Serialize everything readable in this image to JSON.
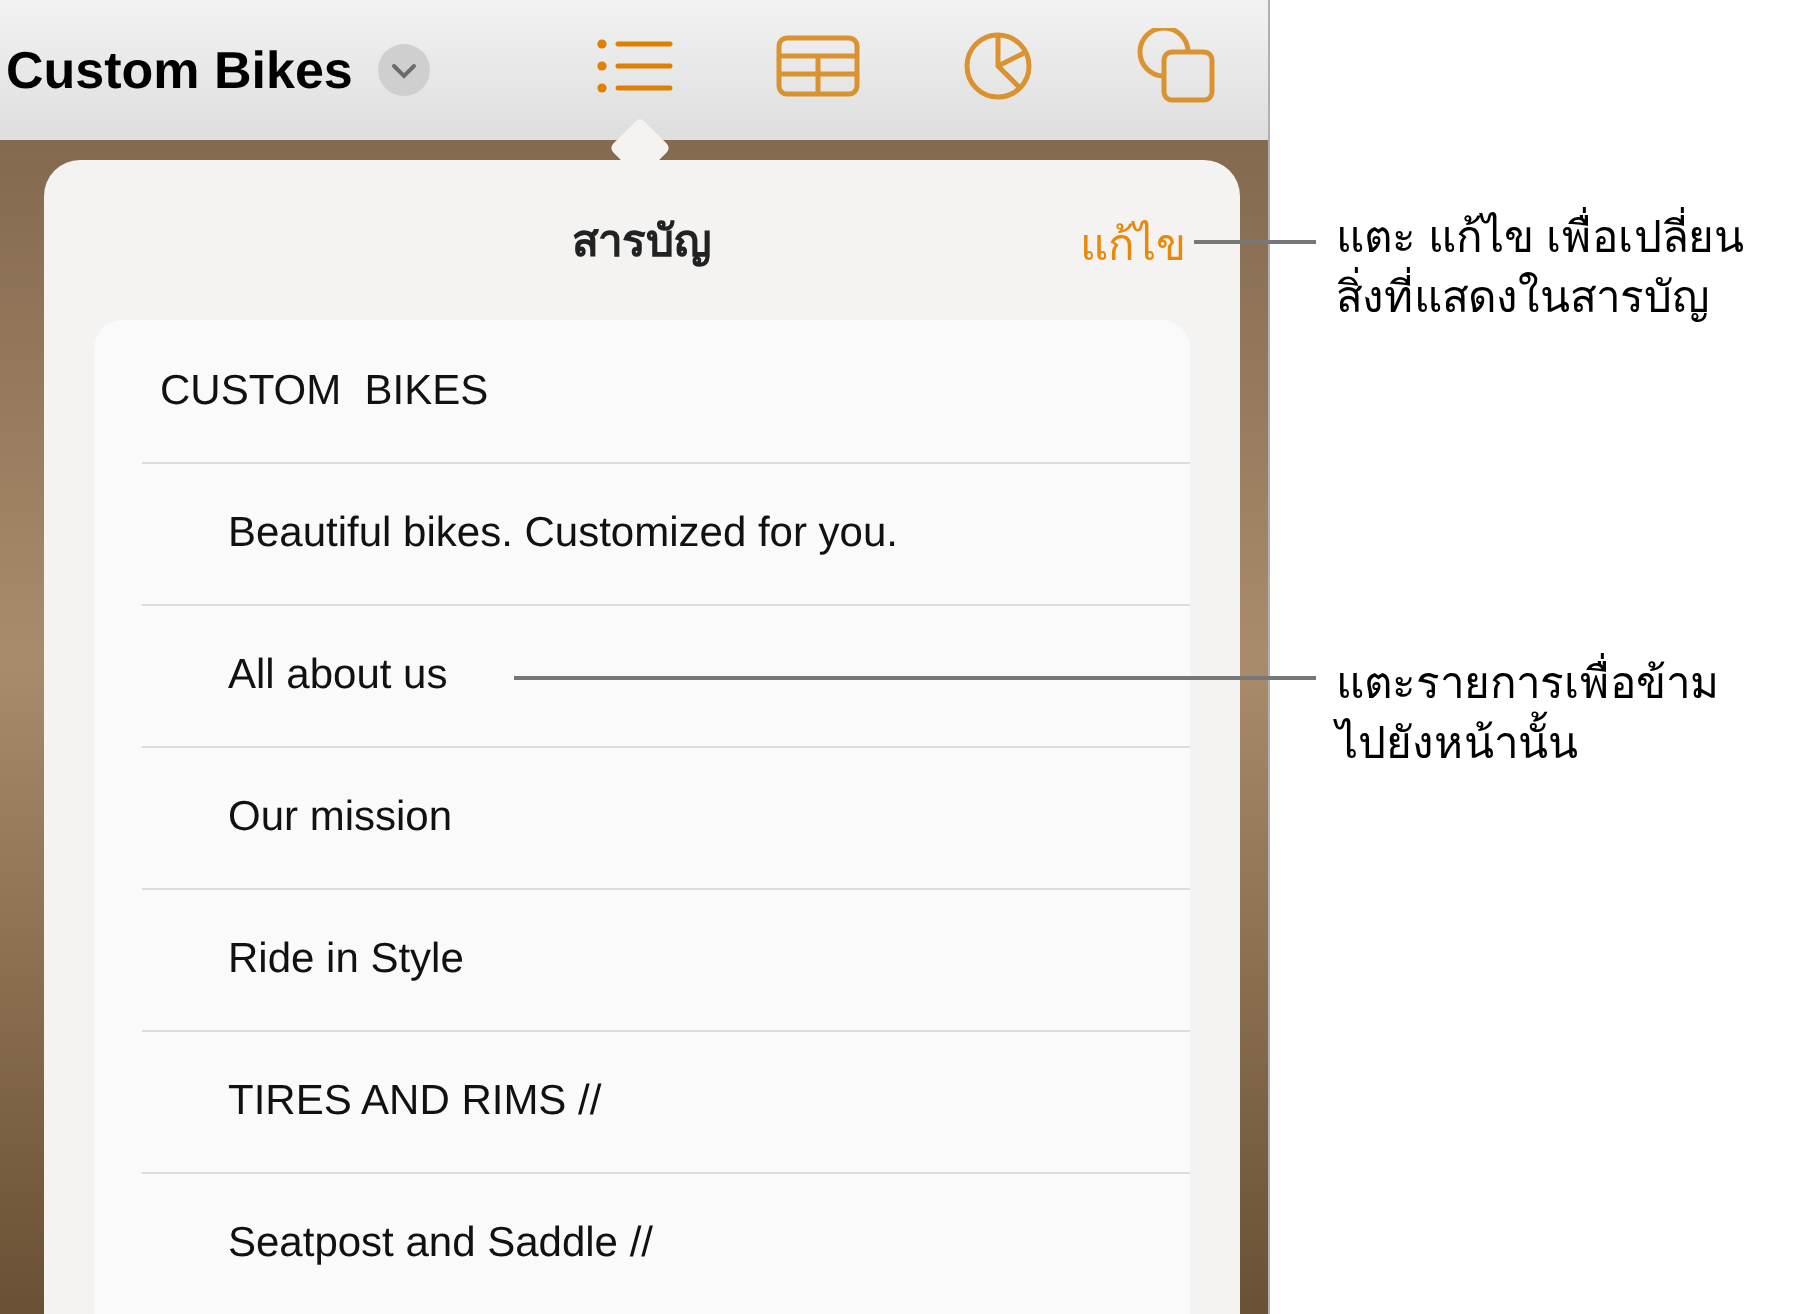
{
  "document": {
    "title": "Custom Bikes"
  },
  "toolbar": {
    "buttons": [
      {
        "kind": "list",
        "selected": true
      },
      {
        "kind": "table",
        "selected": false
      },
      {
        "kind": "chart",
        "selected": false
      },
      {
        "kind": "shapes",
        "selected": false
      }
    ]
  },
  "popover": {
    "title": "สารบัญ",
    "edit_button": "แก้ไข",
    "entries": [
      {
        "label": "CUSTOM  BIKES",
        "children": [
          {
            "label": "Beautiful bikes. Customized for you."
          },
          {
            "label": "All about us"
          },
          {
            "label": "Our mission"
          },
          {
            "label": "Ride in Style"
          },
          {
            "label": "TIRES AND RIMS //"
          },
          {
            "label": "Seatpost and Saddle //"
          }
        ]
      }
    ]
  },
  "callouts": [
    {
      "text": "แตะ แก้ไข เพื่อเปลี่ยน\nสิ่งที่แสดงในสารบัญ"
    },
    {
      "text": "แตะรายการเพื่อข้าม\nไปยังหน้านั้น"
    }
  ]
}
